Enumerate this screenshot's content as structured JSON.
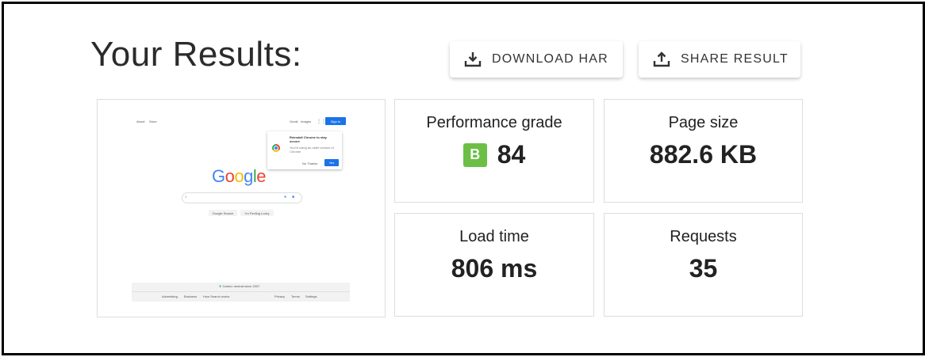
{
  "header": {
    "title": "Your Results:",
    "download_label": "DOWNLOAD HAR",
    "share_label": "SHARE RESULT"
  },
  "metrics": {
    "performance": {
      "label": "Performance grade",
      "grade": "B",
      "value": "84",
      "grade_color": "#6bbf45"
    },
    "page_size": {
      "label": "Page size",
      "value": "882.6 KB"
    },
    "load_time": {
      "label": "Load time",
      "value": "806 ms"
    },
    "requests": {
      "label": "Requests",
      "value": "35"
    }
  },
  "thumbnail": {
    "nav_left": [
      "About",
      "Store"
    ],
    "nav_right": [
      "Gmail",
      "Images"
    ],
    "sign_in": "Sign in",
    "popup_title": "Reinstall Chrome to stay secure",
    "popup_body": "You're using an older version of Chrome",
    "popup_no": "No Thanks",
    "popup_yes": "Yes",
    "logo_letters": [
      "G",
      "o",
      "o",
      "g",
      "l",
      "e"
    ],
    "logo_colors": [
      "#4285f4",
      "#ea4335",
      "#fbbc05",
      "#4285f4",
      "#34a853",
      "#ea4335"
    ],
    "search_btn": "Google Search",
    "lucky_btn": "I'm Feeling Lucky",
    "footer_top": "Carbon neutral since 2007",
    "footer_left": [
      "Advertising",
      "Business",
      "How Search works"
    ],
    "footer_right": [
      "Privacy",
      "Terms",
      "Settings"
    ]
  }
}
